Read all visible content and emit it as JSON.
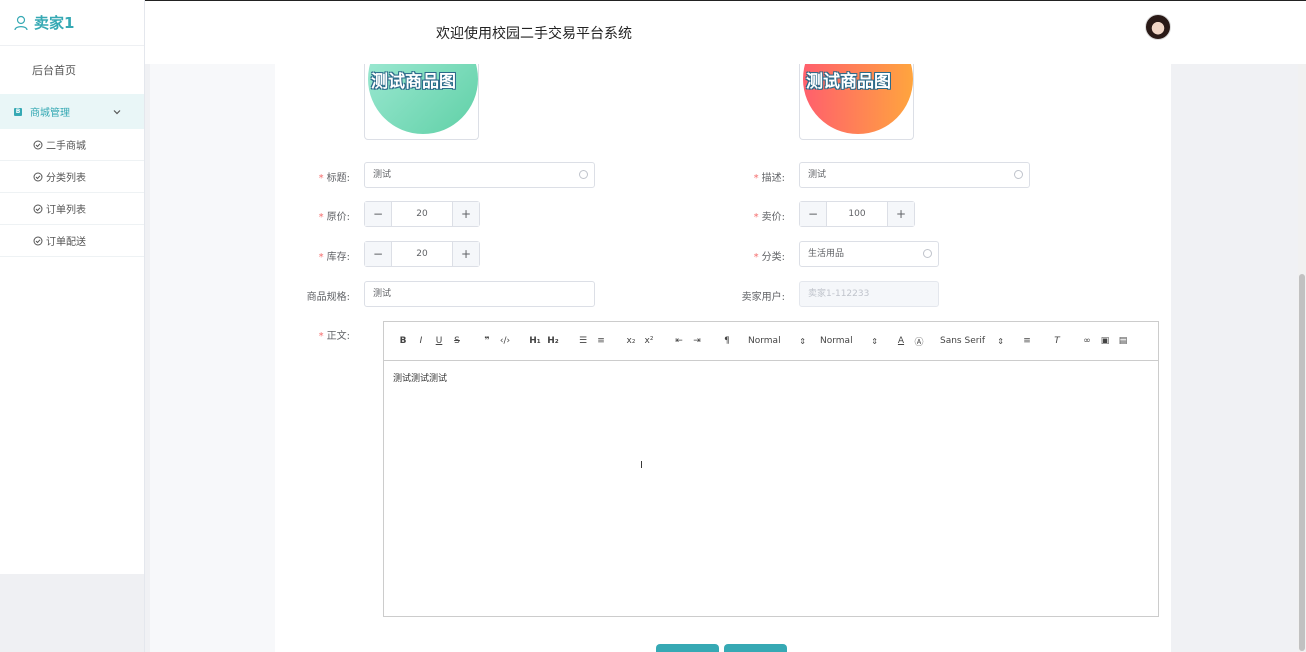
{
  "sidebar": {
    "brand": "卖家1",
    "home": "后台首页",
    "group": "商城管理",
    "items": [
      {
        "label": "二手商城"
      },
      {
        "label": "分类列表"
      },
      {
        "label": "订单列表"
      },
      {
        "label": "订单配送"
      }
    ]
  },
  "header": {
    "title": "欢迎使用校园二手交易平台系统"
  },
  "form": {
    "image_text_1": "测试商品图",
    "image_text_2": "测试商品图",
    "title_label": "标题:",
    "title_value": "测试",
    "desc_label": "描述:",
    "desc_value": "测试",
    "orig_price_label": "原价:",
    "orig_price_value": "20",
    "price_label": "卖价:",
    "price_value": "100",
    "stock_label": "库存:",
    "stock_value": "20",
    "category_label": "分类:",
    "category_value": "生活用品",
    "spec_label": "商品规格:",
    "spec_value": "测试",
    "seller_label": "卖家用户:",
    "seller_value": "卖家1-112233",
    "body_label": "正文:",
    "body_value": "测试测试测试"
  },
  "toolbar": {
    "header_picker": "Normal",
    "size_picker": "Normal",
    "font_picker": "Sans Serif",
    "h1": "H₁",
    "h2": "H₂"
  },
  "colors": {
    "accent": "#36a9b4"
  }
}
